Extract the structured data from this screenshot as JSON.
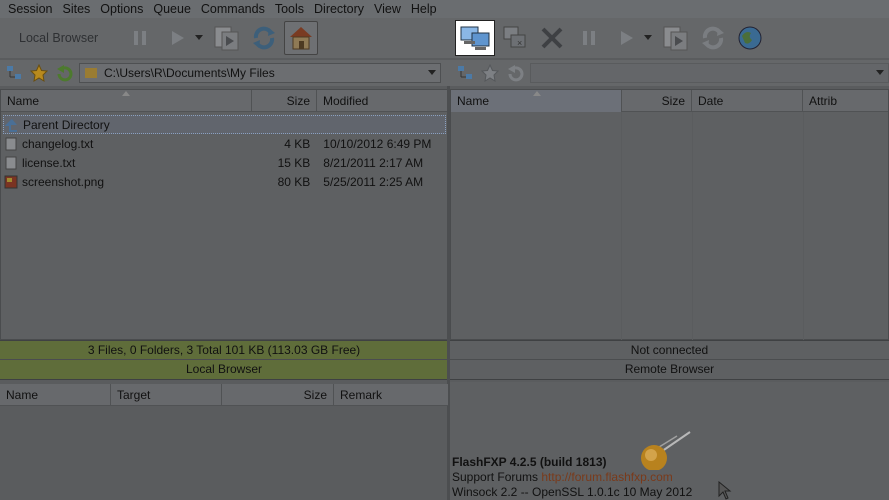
{
  "menu": [
    "Session",
    "Sites",
    "Options",
    "Queue",
    "Commands",
    "Tools",
    "Directory",
    "View",
    "Help"
  ],
  "toolbar_left": {
    "local_browser_label": "Local Browser",
    "buttons": [
      "pause",
      "play",
      "transfer",
      "refresh",
      "home"
    ]
  },
  "toolbar_right": {
    "buttons": [
      "connect",
      "disconnect",
      "abort",
      "pause",
      "play",
      "transfer",
      "refresh",
      "web"
    ]
  },
  "local": {
    "path": "C:\\Users\\R\\Documents\\My Files",
    "columns": [
      "Name",
      "Size",
      "Modified"
    ],
    "files": [
      {
        "name": "Parent Directory",
        "size": "",
        "modified": "",
        "icon": "up-arrow-icon"
      },
      {
        "name": "changelog.txt",
        "size": "4 KB",
        "modified": "10/10/2012 6:49 PM",
        "icon": "text-file-icon"
      },
      {
        "name": "license.txt",
        "size": "15 KB",
        "modified": "8/21/2011 2:17 AM",
        "icon": "text-file-icon"
      },
      {
        "name": "screenshot.png",
        "size": "80 KB",
        "modified": "5/25/2011 2:25 AM",
        "icon": "image-file-icon"
      }
    ],
    "status": "3 Files, 0 Folders, 3 Total 101 KB (113.03 GB Free)",
    "status_label": "Local Browser"
  },
  "remote": {
    "path": "",
    "columns": [
      "Name",
      "Size",
      "Date",
      "Attrib"
    ],
    "status": "Not connected",
    "status_label": "Remote Browser"
  },
  "queue": {
    "columns": [
      "Name",
      "Target",
      "Size",
      "Remark"
    ]
  },
  "log": {
    "version": "FlashFXP 4.2.5 (build 1813)",
    "support_prefix": "Support Forums ",
    "support_url": "http://forum.flashfxp.com",
    "winsock": "Winsock 2.2 -- OpenSSL 1.0.1c 10 May 2012"
  }
}
